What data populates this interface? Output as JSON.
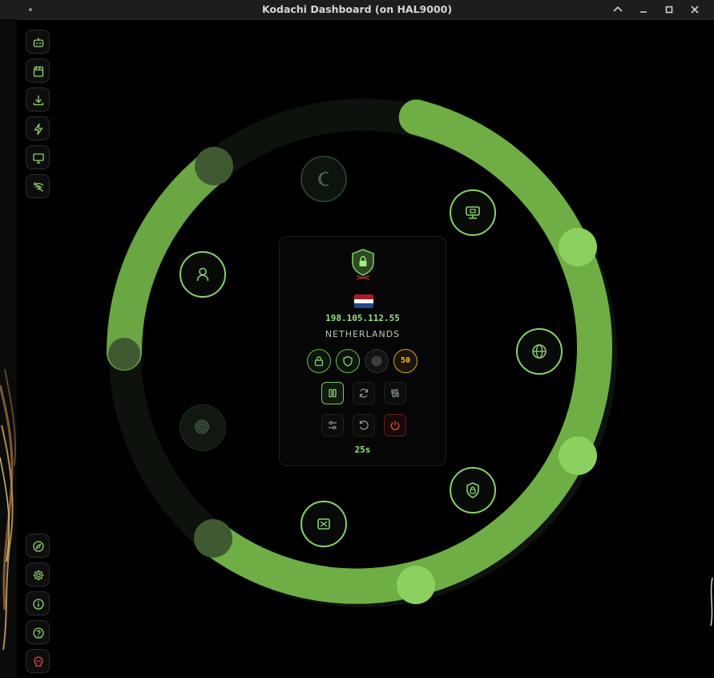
{
  "window": {
    "title": "Kodachi Dashboard (on HAL9000)",
    "controls": [
      "chevron-up-icon",
      "minimize-icon",
      "maximize-icon",
      "close-icon"
    ]
  },
  "sidebar": {
    "top_items": [
      "robot-icon",
      "clapperboard-icon",
      "download-icon",
      "lightning-icon",
      "monitor-icon",
      "wifi-off-icon"
    ],
    "bottom_items": [
      "compass-icon",
      "gear-icon",
      "info-icon",
      "help-icon",
      "skull-icon"
    ]
  },
  "ring": {
    "accent": "#6fae44",
    "orbit_icons": [
      "crescent-icon",
      "monitor-network-icon",
      "globe-icon",
      "shield-lock-icon",
      "crosshair-box-icon",
      "fingerprint-icon",
      "user-icon"
    ]
  },
  "status": {
    "ip": "198.105.112.55",
    "country": "NETHERLANDS",
    "flag_colors": [
      "#ae1c28",
      "#ffffff",
      "#21468b"
    ],
    "score": "50",
    "timer": "25s"
  },
  "colors": {
    "green": "#86d26a",
    "score_yellow": "#f2c22e",
    "power_red": "#e04848"
  }
}
